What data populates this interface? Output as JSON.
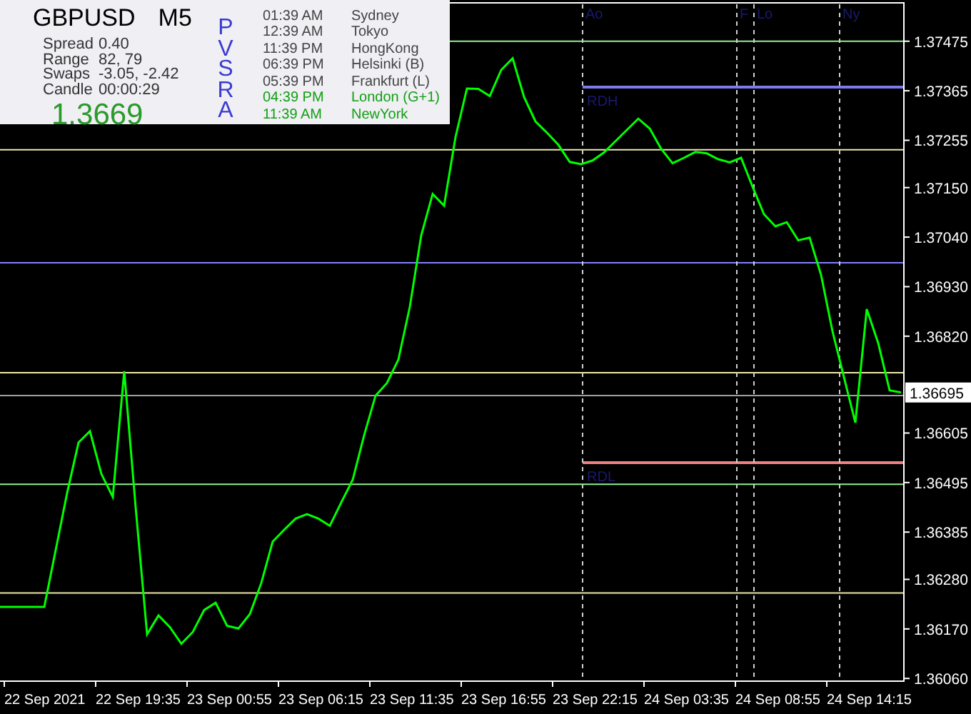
{
  "info_panel": {
    "symbol": "GBPUSD",
    "timeframe": "M5",
    "stats": [
      {
        "label": "Spread",
        "value": "0.40"
      },
      {
        "label": "Range",
        "value": "82, 79"
      },
      {
        "label": "Swaps",
        "value": "-3.05, -2.42"
      },
      {
        "label": "Candle",
        "value": "00:00:29"
      }
    ],
    "price": "1.3669",
    "indicator": "PVSRA",
    "sessions": [
      {
        "time": "01:39 AM",
        "city": "Sydney",
        "active": false
      },
      {
        "time": "12:39 AM",
        "city": "Tokyo",
        "active": false
      },
      {
        "time": "11:39 PM",
        "city": "HongKong",
        "active": false
      },
      {
        "time": "06:39 PM",
        "city": "Helsinki  (B)",
        "active": false
      },
      {
        "time": "05:39 PM",
        "city": "Frankfurt  (L)",
        "active": false
      },
      {
        "time": "04:39 PM",
        "city": "London  (G+1)",
        "active": true
      },
      {
        "time": "11:39 AM",
        "city": "NewYork",
        "active": true
      }
    ]
  },
  "chart": {
    "current_price": "1.36695",
    "chart_data": {
      "type": "line",
      "categories": [
        "22 Sep 2021",
        null,
        null,
        null,
        null,
        null,
        null,
        null,
        "22 Sep 19:35",
        null,
        null,
        null,
        null,
        null,
        null,
        null,
        "23 Sep 00:55",
        null,
        null,
        null,
        null,
        null,
        null,
        null,
        "23 Sep 06:15",
        null,
        null,
        null,
        null,
        null,
        null,
        null,
        "23 Sep 11:35",
        null,
        null,
        null,
        null,
        null,
        null,
        null,
        "23 Sep 16:55",
        null,
        null,
        null,
        null,
        null,
        null,
        null,
        "23 Sep 22:15",
        null,
        null,
        null,
        null,
        null,
        null,
        null,
        "24 Sep 03:35",
        null,
        null,
        null,
        null,
        null,
        null,
        null,
        "24 Sep 08:55",
        null,
        null,
        null,
        null,
        null,
        null,
        null,
        "24 Sep 14:15",
        null,
        null,
        null
      ],
      "series": [
        {
          "color": "#00ff00",
          "values": [
            1.36219,
            1.36345,
            1.36472,
            1.36584,
            1.36609,
            1.36514,
            1.36463,
            1.36742,
            1.3644,
            1.36158,
            1.362,
            1.36174,
            1.36137,
            1.36163,
            1.36212,
            1.36228,
            1.36177,
            1.36171,
            1.36203,
            1.36272,
            1.36364,
            1.3639,
            1.36415,
            1.36425,
            1.36415,
            1.36399,
            1.36451,
            1.36501,
            1.366,
            1.36688,
            1.36716,
            1.36768,
            1.36885,
            1.37044,
            1.37136,
            1.3711,
            1.37262,
            1.3737,
            1.37369,
            1.37353,
            1.37411,
            1.37437,
            1.37351,
            1.37297,
            1.37272,
            1.37245,
            1.37207,
            1.37202,
            1.3721,
            1.37228,
            1.37253,
            1.37278,
            1.37303,
            1.37281,
            1.37236,
            1.37204,
            1.37216,
            1.37229,
            1.37226,
            1.37213,
            1.37206,
            1.37216,
            1.37152,
            1.37091,
            1.37064,
            1.37073,
            1.37033,
            1.37039,
            1.36956,
            1.36831,
            1.36729,
            1.36628,
            1.3688,
            1.36805,
            1.367,
            1.36695
          ]
        }
      ],
      "ylim": [
        1.36054,
        1.37557
      ],
      "yticks": [
        {
          "value": 1.37475,
          "label": "1.37475"
        },
        {
          "value": 1.37365,
          "label": "1.37365"
        },
        {
          "value": 1.37255,
          "label": "1.37255"
        },
        {
          "value": 1.3715,
          "label": "1.37150"
        },
        {
          "value": 1.3704,
          "label": "1.37040"
        },
        {
          "value": 1.3693,
          "label": "1.36930"
        },
        {
          "value": 1.3682,
          "label": "1.36820"
        },
        {
          "value": 1.36605,
          "label": "1.36605"
        },
        {
          "value": 1.36495,
          "label": "1.36495"
        },
        {
          "value": 1.36385,
          "label": "1.36385"
        },
        {
          "value": 1.3628,
          "label": "1.36280"
        },
        {
          "value": 1.3617,
          "label": "1.36170"
        },
        {
          "value": 1.3606,
          "label": "1.36060"
        }
      ],
      "ref_lines": [
        {
          "axis": "y",
          "value": 1.37475,
          "color": "#90ee90"
        },
        {
          "axis": "y",
          "value": 1.37373,
          "color": "#7b7bee",
          "label": "RDH"
        },
        {
          "axis": "y",
          "value": 1.37234,
          "color": "#eee8aa"
        },
        {
          "axis": "y",
          "value": 1.36983,
          "color": "#8080ff"
        },
        {
          "axis": "y",
          "value": 1.36739,
          "color": "#eee8aa"
        },
        {
          "axis": "y",
          "value": 1.36688,
          "color": "#a0a0a0"
        },
        {
          "axis": "y",
          "value": 1.36539,
          "color": "#f08080",
          "label": "RDL"
        },
        {
          "axis": "y",
          "value": 1.36491,
          "color": "#90ee90"
        },
        {
          "axis": "y",
          "value": 1.3625,
          "color": "#eee8aa"
        }
      ]
    },
    "session_markers": [
      {
        "label": "Ao"
      },
      {
        "label": "F"
      },
      {
        "label": "Lo"
      },
      {
        "label": "Ny"
      }
    ]
  }
}
